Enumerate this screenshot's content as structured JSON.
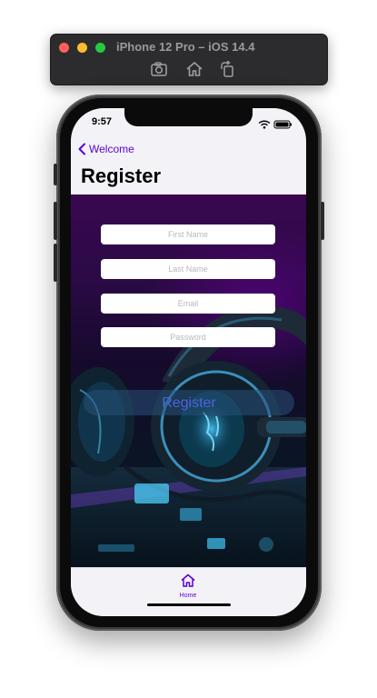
{
  "simulator": {
    "title": "iPhone 12 Pro – iOS 14.4",
    "tools": [
      "screenshot-icon",
      "home-icon",
      "rotate-icon"
    ]
  },
  "status_bar": {
    "time": "9:57"
  },
  "nav": {
    "back_label": "Welcome",
    "title": "Register"
  },
  "form": {
    "first_name": {
      "placeholder": "First Name",
      "value": ""
    },
    "last_name": {
      "placeholder": "Last Name",
      "value": ""
    },
    "email": {
      "placeholder": "Email",
      "value": ""
    },
    "password": {
      "placeholder": "Password",
      "value": ""
    },
    "submit_label": "Register"
  },
  "tab_bar": {
    "items": [
      {
        "label": "Home",
        "icon": "home-icon"
      }
    ]
  },
  "colors": {
    "accent": "#5d00d6",
    "button_text": "#4c62e0",
    "traffic_red": "#ff5f57",
    "traffic_yellow": "#febc2e",
    "traffic_green": "#28c840"
  }
}
